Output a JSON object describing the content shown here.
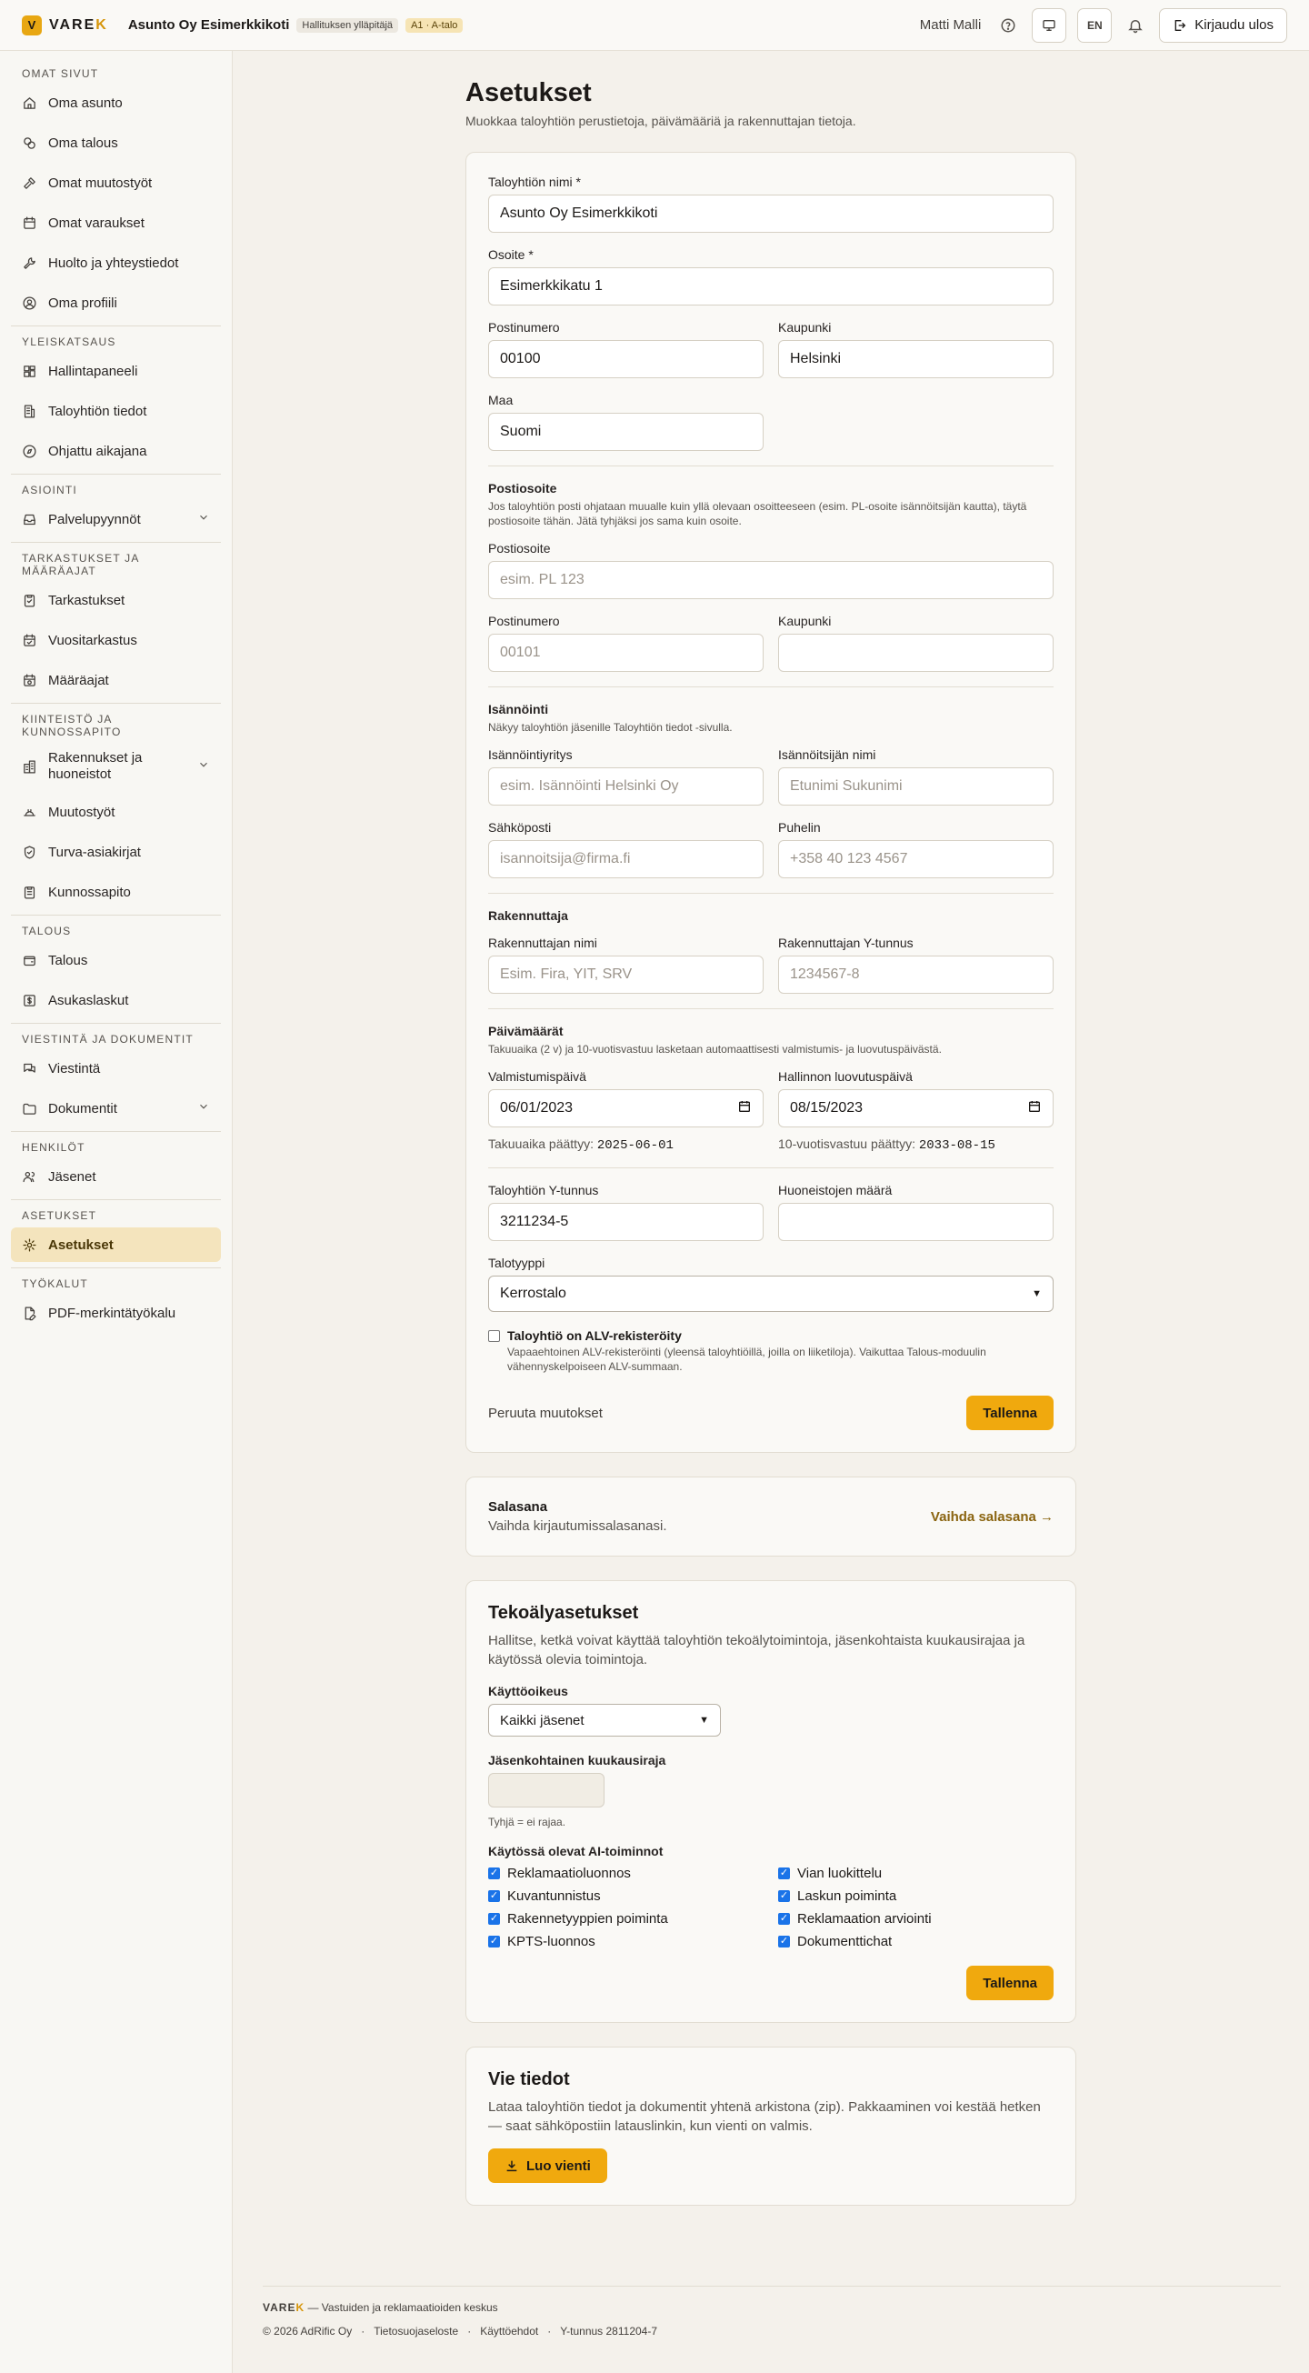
{
  "topbar": {
    "logo_prefix": "VARE",
    "logo_suffix": "K",
    "logo_mark": "V",
    "org_name": "Asunto Oy Esimerkkikoti",
    "role_badge": "Hallituksen ylläpitäjä",
    "unit_badge": "A1 · A-talo",
    "user_name": "Matti Malli",
    "lang_button": "EN",
    "logout_label": "Kirjaudu ulos"
  },
  "sidebar": {
    "sections": [
      {
        "title": "OMAT SIVUT",
        "items": [
          {
            "label": "Oma asunto",
            "icon": "home-icon"
          },
          {
            "label": "Oma talous",
            "icon": "coins-icon"
          },
          {
            "label": "Omat muutostyöt",
            "icon": "hammer-icon"
          },
          {
            "label": "Omat varaukset",
            "icon": "calendar-icon"
          },
          {
            "label": "Huolto ja yhteystiedot",
            "icon": "wrench-icon"
          },
          {
            "label": "Oma profiili",
            "icon": "user-circle-icon"
          }
        ]
      },
      {
        "title": "YLEISKATSAUS",
        "items": [
          {
            "label": "Hallintapaneeli",
            "icon": "dashboard-icon"
          },
          {
            "label": "Taloyhtiön tiedot",
            "icon": "building-icon"
          },
          {
            "label": "Ohjattu aikajana",
            "icon": "compass-icon"
          }
        ]
      },
      {
        "title": "ASIOINTI",
        "items": [
          {
            "label": "Palvelupyynnöt",
            "icon": "inbox-icon",
            "chevron": true
          }
        ]
      },
      {
        "title": "TARKASTUKSET JA MÄÄRÄAJAT",
        "items": [
          {
            "label": "Tarkastukset",
            "icon": "clipboard-check-icon"
          },
          {
            "label": "Vuositarkastus",
            "icon": "calendar-check-icon"
          },
          {
            "label": "Määräajat",
            "icon": "calendar-clock-icon"
          }
        ]
      },
      {
        "title": "KIINTEISTÖ JA KUNNOSSAPITO",
        "items": [
          {
            "label": "Rakennukset ja huoneistot",
            "icon": "buildings-icon",
            "chevron": true,
            "tall": true
          },
          {
            "label": "Muutostyöt",
            "icon": "hardhat-icon"
          },
          {
            "label": "Turva-asiakirjat",
            "icon": "shield-icon"
          },
          {
            "label": "Kunnossapito",
            "icon": "clipboard-list-icon"
          }
        ]
      },
      {
        "title": "TALOUS",
        "items": [
          {
            "label": "Talous",
            "icon": "wallet-icon"
          },
          {
            "label": "Asukaslaskut",
            "icon": "receipt-icon"
          }
        ]
      },
      {
        "title": "VIESTINTÄ JA DOKUMENTIT",
        "items": [
          {
            "label": "Viestintä",
            "icon": "messages-icon"
          },
          {
            "label": "Dokumentit",
            "icon": "folder-icon",
            "chevron": true
          }
        ]
      },
      {
        "title": "HENKILÖT",
        "items": [
          {
            "label": "Jäsenet",
            "icon": "users-icon"
          }
        ]
      },
      {
        "title": "ASETUKSET",
        "items": [
          {
            "label": "Asetukset",
            "icon": "gear-icon",
            "active": true
          }
        ]
      },
      {
        "title": "TYÖKALUT",
        "items": [
          {
            "label": "PDF-merkintätyökalu",
            "icon": "file-pen-icon"
          }
        ]
      }
    ]
  },
  "page": {
    "title": "Asetukset",
    "subtitle": "Muokkaa taloyhtiön perustietoja, päivämääriä ja rakennuttajan tietoja."
  },
  "form": {
    "name_label": "Taloyhtiön nimi *",
    "name_value": "Asunto Oy Esimerkkikoti",
    "address_label": "Osoite *",
    "address_value": "Esimerkkikatu 1",
    "postal_label": "Postinumero",
    "postal_value": "00100",
    "city_label": "Kaupunki",
    "city_value": "Helsinki",
    "country_label": "Maa",
    "country_value": "Suomi",
    "postal_address_title": "Postiosoite",
    "postal_address_help": "Jos taloyhtiön posti ohjataan muualle kuin yllä olevaan osoitteeseen (esim. PL-osoite isännöitsijän kautta), täytä postiosoite tähän. Jätä tyhjäksi jos sama kuin osoite.",
    "po_label": "Postiosoite",
    "po_placeholder": "esim. PL 123",
    "po_postal_label": "Postinumero",
    "po_postal_placeholder": "00101",
    "po_city_label": "Kaupunki",
    "po_city_placeholder": "",
    "mgmt_title": "Isännöinti",
    "mgmt_help": "Näkyy taloyhtiön jäsenille Taloyhtiön tiedot -sivulla.",
    "mgmt_company_label": "Isännöintiyritys",
    "mgmt_company_placeholder": "esim. Isännöinti Helsinki Oy",
    "manager_label": "Isännöitsijän nimi",
    "manager_placeholder": "Etunimi Sukunimi",
    "email_label": "Sähköposti",
    "email_placeholder": "isannoitsija@firma.fi",
    "phone_label": "Puhelin",
    "phone_placeholder": "+358 40 123 4567",
    "builder_title": "Rakennuttaja",
    "builder_name_label": "Rakennuttajan nimi",
    "builder_name_placeholder": "Esim. Fira, YIT, SRV",
    "builder_id_label": "Rakennuttajan Y-tunnus",
    "builder_id_placeholder": "1234567-8",
    "dates_title": "Päivämäärät",
    "dates_help": "Takuuaika (2 v) ja 10-vuotisvastuu lasketaan automaattisesti valmistumis- ja luovutuspäivästä.",
    "completion_label": "Valmistumispäivä",
    "completion_value": "06/01/2023",
    "handover_label": "Hallinnon luovutuspäivä",
    "handover_value": "08/15/2023",
    "warranty_label": "Takuuaika päättyy:",
    "warranty_value": "2025-06-01",
    "liability_label": "10-vuotisvastuu päättyy:",
    "liability_value": "2033-08-15",
    "business_id_label": "Taloyhtiön Y-tunnus",
    "business_id_value": "3211234-5",
    "apartments_label": "Huoneistojen määrä",
    "apartments_value": "",
    "house_type_label": "Talotyyppi",
    "house_type_value": "Kerrostalo",
    "vat_title": "Taloyhtiö on ALV-rekisteröity",
    "vat_desc": "Vapaaehtoinen ALV-rekisteröinti (yleensä taloyhtiöillä, joilla on liiketiloja). Vaikuttaa Talous-moduulin vähennyskelpoiseen ALV-summaan.",
    "vat_checked": false,
    "cancel_label": "Peruuta muutokset",
    "save_label": "Tallenna"
  },
  "password": {
    "title": "Salasana",
    "desc": "Vaihda kirjautumissalasanasi.",
    "link": "Vaihda salasana →"
  },
  "ai": {
    "title": "Tekoälyasetukset",
    "desc": "Hallitse, ketkä voivat käyttää taloyhtiön tekoälytoimintoja, jäsenkohtaista kuukausirajaa ja käytössä olevia toimintoja.",
    "access_label": "Käyttöoikeus",
    "access_value": "Kaikki jäsenet",
    "limit_label": "Jäsenkohtainen kuukausiraja",
    "limit_value": "",
    "limit_help": "Tyhjä = ei rajaa.",
    "features_label": "Käytössä olevat AI-toiminnot",
    "features": [
      {
        "label": "Reklamaatioluonnos",
        "checked": true
      },
      {
        "label": "Vian luokittelu",
        "checked": true
      },
      {
        "label": "Kuvantunnistus",
        "checked": true
      },
      {
        "label": "Laskun poiminta",
        "checked": true
      },
      {
        "label": "Rakennetyyppien poiminta",
        "checked": true
      },
      {
        "label": "Reklamaation arviointi",
        "checked": true
      },
      {
        "label": "KPTS-luonnos",
        "checked": true
      },
      {
        "label": "Dokumenttichat",
        "checked": true
      }
    ],
    "save_label": "Tallenna"
  },
  "export": {
    "title": "Vie tiedot",
    "desc": "Lataa taloyhtiön tiedot ja dokumentit yhtenä arkistona (zip). Pakkaaminen voi kestää hetken — saat sähköpostiin latauslinkin, kun vienti on valmis.",
    "button": "Luo vienti"
  },
  "footer": {
    "brand_prefix": "VARE",
    "brand_suffix": "K",
    "tagline": " — Vastuiden ja reklamaatioiden keskus",
    "copyright": "© 2026 AdRific Oy",
    "sep": "·",
    "privacy": "Tietosuojaseloste",
    "terms": "Käyttöehdot",
    "business_id": "Y-tunnus 2811204-7"
  },
  "colors": {
    "accent": "#f0a90e",
    "active_nav_bg": "#f4e4bd",
    "page_bg": "#f4f1eb",
    "link": "#8a6410"
  }
}
